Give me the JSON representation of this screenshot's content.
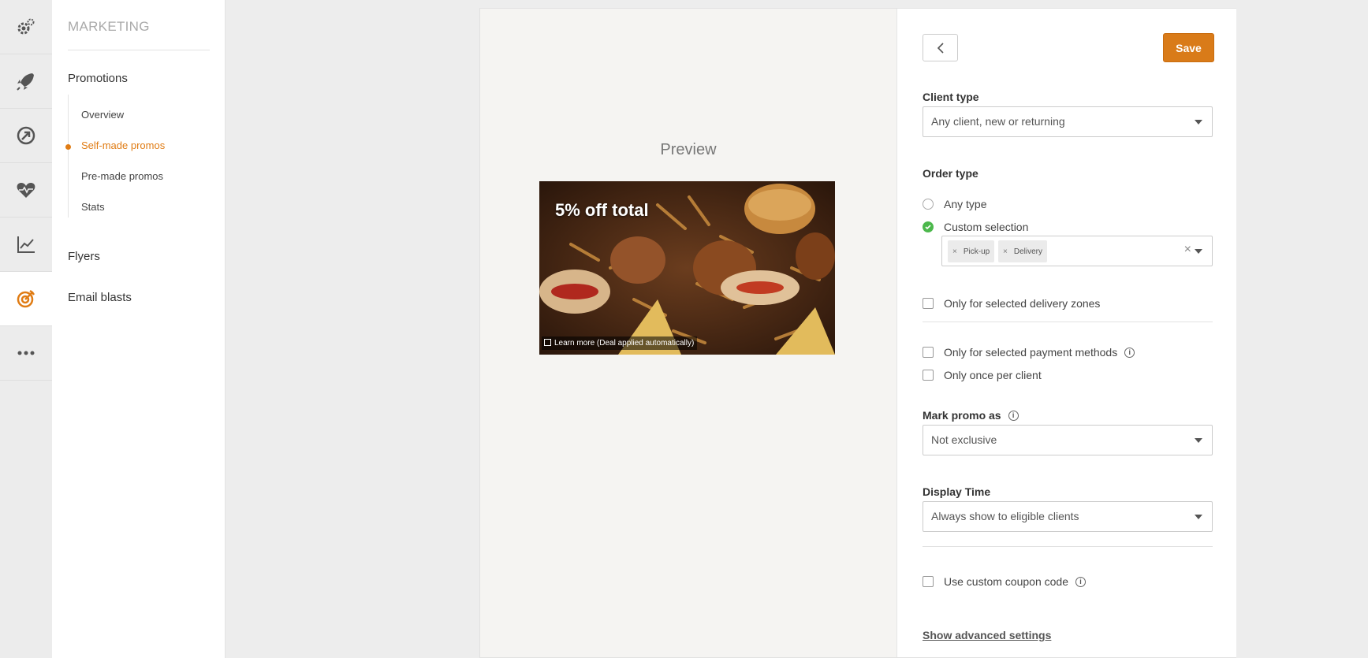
{
  "rail": {
    "items": [
      {
        "icon": "gears-icon"
      },
      {
        "icon": "rocket-icon"
      },
      {
        "icon": "arrow-circle-icon"
      },
      {
        "icon": "heart-pulse-icon"
      },
      {
        "icon": "line-chart-icon"
      },
      {
        "icon": "target-icon",
        "active": true
      },
      {
        "icon": "more-dots-icon"
      }
    ],
    "accent": "#e07c14"
  },
  "subnav": {
    "title": "MARKETING",
    "promotions": "Promotions",
    "sub_items": [
      "Overview",
      "Self-made promos",
      "Pre-made promos",
      "Stats"
    ],
    "active_sub": "Self-made promos",
    "flyers": "Flyers",
    "email_blasts": "Email blasts"
  },
  "preview": {
    "title": "Preview",
    "promo_text": "5% off total",
    "learn_more": "Learn more (Deal applied automatically)"
  },
  "panel": {
    "save_label": "Save",
    "client_type": {
      "label": "Client type",
      "value": "Any client, new or returning"
    },
    "order_type": {
      "label": "Order type",
      "any_type": "Any type",
      "custom_selection": "Custom selection",
      "selected": "Custom selection",
      "tags": [
        "Pick-up",
        "Delivery"
      ]
    },
    "delivery_zones": "Only for selected delivery zones",
    "payment_methods": "Only for selected payment methods",
    "once_per_client": "Only once per client",
    "mark_promo": {
      "label": "Mark promo as",
      "value": "Not exclusive"
    },
    "display_time": {
      "label": "Display Time",
      "value": "Always show to eligible clients"
    },
    "coupon_code": "Use custom coupon code",
    "advanced_link": "Show advanced settings",
    "save_color": "#d97b19",
    "check_color": "#4cb84c"
  }
}
